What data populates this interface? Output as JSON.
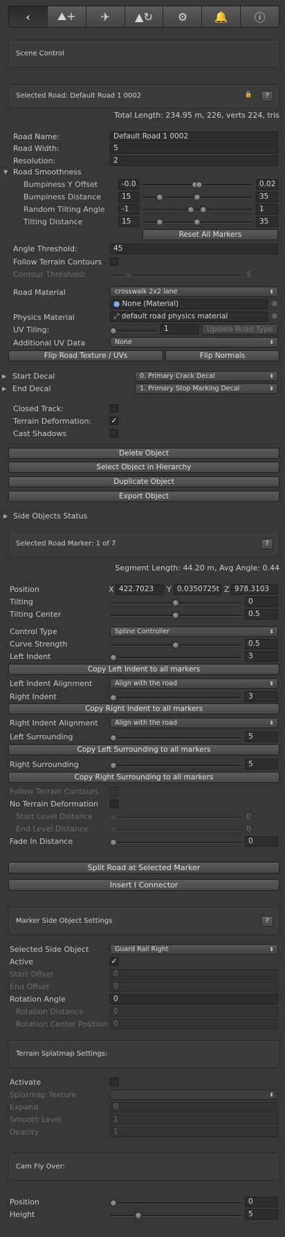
{
  "toolbar": {
    "buttons": [
      {
        "icon": "back-arrow-icon",
        "glyph": "‹"
      },
      {
        "icon": "add-road-icon",
        "glyph": "⛰+"
      },
      {
        "icon": "airplane-icon",
        "glyph": "✈"
      },
      {
        "icon": "terrain-refresh-icon",
        "glyph": "▲↻"
      },
      {
        "icon": "gear-icon",
        "glyph": "⚙"
      },
      {
        "icon": "bell-icon",
        "glyph": "🔔"
      },
      {
        "icon": "info-icon",
        "glyph": "ⓘ"
      }
    ]
  },
  "scene_control": {
    "title": "Scene Control"
  },
  "selected_road": {
    "title": "Selected Road:  Default Road 1 0002",
    "help": "?",
    "total_length": "Total Length: 234.95 m, 226, verts 224, tris"
  },
  "road": {
    "name_label": "Road Name:",
    "name_value": "Default Road 1 0002",
    "width_label": "Road Width:",
    "width_value": "5",
    "resolution_label": "Resolution:",
    "resolution_value": "2",
    "smoothness_label": "Road Smoothness",
    "bump_y_label": "Bumpiness Y Offset",
    "bump_y_min": "-0.0",
    "bump_y_max": "0.02",
    "bump_dist_label": "Bumpiness Distance",
    "bump_dist_min": "15",
    "bump_dist_max": "35",
    "tilt_angle_label": "Random Tilting Angle",
    "tilt_angle_min": "-1",
    "tilt_angle_max": "1",
    "tilt_dist_label": "Tilting Distance",
    "tilt_dist_min": "15",
    "tilt_dist_max": "35",
    "reset_markers": "Reset All Markers",
    "angle_threshold_label": "Angle Threshold:",
    "angle_threshold_value": "45",
    "follow_terrain_label": "Follow Terrain Contours",
    "contour_threshold_label": "Contour Threshold:",
    "contour_threshold_value": "5",
    "material_label": "Road Material",
    "material_value": "crosswalk 2x2 lane",
    "material2_value": "None (Material)",
    "physics_label": "Physics Material",
    "physics_value": "default road physics material",
    "uv_tiling_label": "UV Tiling:",
    "uv_tiling_value": "1",
    "update_road_type": "Update Road Type",
    "additional_uv_label": "Additional UV Data",
    "additional_uv_value": "None",
    "flip_texture": "Flip Road Texture / UVs",
    "flip_normals": "Flip Normals",
    "start_decal_label": "Start Decal",
    "start_decal_value": "0. Primary Crack Decal",
    "end_decal_label": "End Decal",
    "end_decal_value": "1. Primary Stop Marking Decal",
    "closed_track_label": "Closed Track:",
    "terrain_deformation_label": "Terrain Deformation:",
    "terrain_deformation_check": "✓",
    "cast_shadows_label": "Cast Shadows",
    "delete_object": "Delete Object",
    "select_in_hierarchy": "Select Object in Hierarchy",
    "duplicate_object": "Duplicate Object",
    "export_object": "Export Object",
    "side_objects_status": "Side Objects Status"
  },
  "marker": {
    "title": "Selected Road Marker: 1 of 7",
    "help": "?",
    "segment_info": "Segment Length: 44.20 m, Avg Angle: 0.44",
    "position_label": "Position",
    "pos_x_label": "X",
    "pos_x": "422.7023",
    "pos_y_label": "Y",
    "pos_y": "0.0350725t",
    "pos_z_label": "Z",
    "pos_z": "978.3103",
    "tilting_label": "Tilting",
    "tilting_value": "0",
    "tilting_fraction": 0.5,
    "tilting_center_label": "Tilting Center",
    "tilting_center_value": "0.5",
    "tilting_center_fraction": 0.5,
    "control_type_label": "Control Type",
    "control_type_value": "Spline Controller",
    "curve_strength_label": "Curve Strength",
    "curve_strength_value": "0.5",
    "curve_strength_fraction": 0.5,
    "left_indent_label": "Left Indent",
    "left_indent_value": "3",
    "left_indent_fraction": 0,
    "copy_left_indent": "Copy Left Indent to all markers",
    "left_indent_align_label": "Left Indent Alignment",
    "left_indent_align_value": "Align with the road",
    "right_indent_label": "Right Indent",
    "right_indent_value": "3",
    "right_indent_fraction": 0,
    "copy_right_indent": "Copy Right Indent to all markers",
    "right_indent_align_label": "Right Indent Alignment",
    "right_indent_align_value": "Align with the road",
    "left_surrounding_label": "Left Surrounding",
    "left_surrounding_value": "5",
    "left_surrounding_fraction": 0,
    "copy_left_surrounding": "Copy Left Surrounding to all markers",
    "right_surrounding_label": "Right Surrounding",
    "right_surrounding_value": "5",
    "right_surrounding_fraction": 0,
    "copy_right_surrounding": "Copy Right Surrounding to all markers",
    "follow_terrain_label": "Follow Terrain Contours",
    "no_terrain_deformation_label": "No Terrain Deformation",
    "start_level_label": "Start Level Distance",
    "start_level_value": "0",
    "end_level_label": "End Level Distance",
    "end_level_value": "0",
    "fade_in_label": "Fade In Distance",
    "fade_in_value": "0",
    "split_road": "Split Road at Selected Marker",
    "insert_connector": "Insert I Connector"
  },
  "side_object": {
    "title": "Marker Side Object Settings",
    "help": "?",
    "selected_label": "Selected Side Object",
    "selected_value": "Guard Rail Right",
    "active_label": "Active",
    "active_check": "✓",
    "start_offset_label": "Start Offset",
    "start_offset_value": "0",
    "end_offset_label": "End Offset",
    "end_offset_value": "0",
    "rotation_angle_label": "Rotation Angle",
    "rotation_angle_value": "0",
    "rotation_distance_label": "Rotation Distance",
    "rotation_distance_value": "0",
    "rotation_center_label": "Rotation Center Position",
    "rotation_center_value": "0"
  },
  "splatmap": {
    "title": "Terrain Splatmap Settings:",
    "activate_label": "Activate",
    "texture_label": "Splatmap Texture",
    "expand_label": "Expand",
    "expand_value": "0",
    "smooth_label": "Smooth Level",
    "smooth_value": "1",
    "opacity_label": "Opacity",
    "opacity_value": "1"
  },
  "cam": {
    "title": "Cam Fly Over:",
    "position_label": "Position",
    "position_value": "0",
    "position_fraction": 0,
    "height_label": "Height",
    "height_value": "5",
    "height_fraction": 0.2
  }
}
